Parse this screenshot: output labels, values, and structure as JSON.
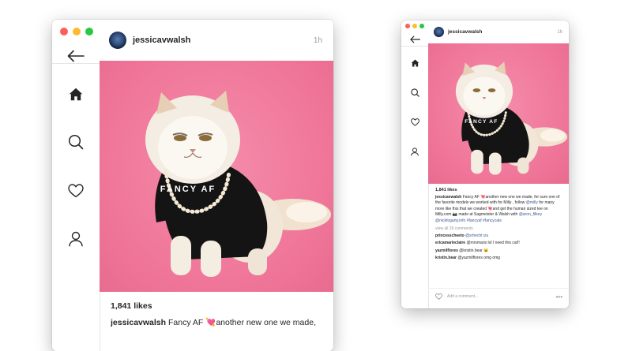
{
  "post": {
    "username": "jessicavwalsh",
    "time": "1h",
    "likes": "1,841 likes",
    "shirt_text": "FANCY AF",
    "caption_user": "jessicavwalsh",
    "caption_emoji": "💘",
    "caption_large": "Fancy AF 💘another new one we made,",
    "caption_part1": " Fancy AF ",
    "caption_part2": "another new one we made, for sure one of the favorite models we worked with for Milly , follow ",
    "mention1": "@milly",
    "caption_part3": " for many more like this that we created ",
    "caption_emoji2": "💘",
    "caption_part4": "and get the human sized tee on Milly.com 📷 made at Sagmeister & Walsh with ",
    "mention2": "@aron_filkey",
    "caption_part5": " ",
    "mention3": "@nickfogarty.info",
    "hashtag1": "#fancyaf",
    "hashtag2": "#fancycats",
    "view_all": "view all 39 comments",
    "comments": [
      {
        "user": "princesscheeto",
        "text": "@srhecht izu"
      },
      {
        "user": "ericamarieclaire",
        "text": "@mrsmaris lol I need this cat!!"
      },
      {
        "user": "yazmilflores",
        "text": "@kristin.bear 😺"
      },
      {
        "user": "kristin.bear",
        "text": "@yazmilflores omg omg"
      }
    ],
    "add_comment_placeholder": "Add a comment...",
    "more_label": "•••"
  },
  "nav": {
    "icons": [
      "back-arrow-icon",
      "home-icon",
      "search-icon",
      "heart-icon",
      "profile-icon"
    ]
  },
  "colors": {
    "photo_bg": "#f27d9e",
    "traffic_red": "#fc5f57",
    "traffic_yellow": "#fdbb2e",
    "traffic_green": "#28c840"
  }
}
